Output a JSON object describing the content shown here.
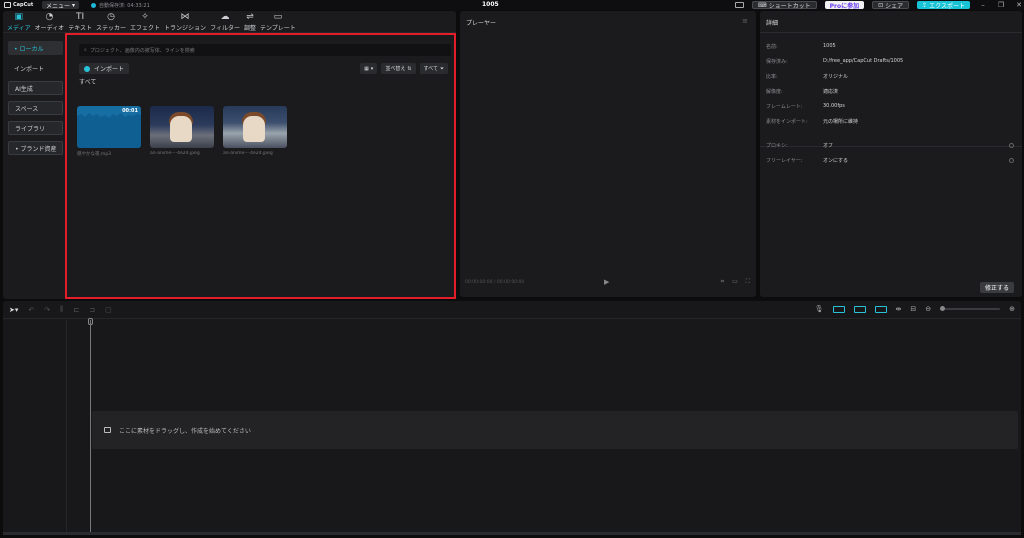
{
  "titlebar": {
    "logo": "CapCut",
    "menu_label": "メニュー",
    "autosave": "自動保存済: 04:33:21",
    "project_title": "1005",
    "shortcut_label": "ショートカット",
    "pro_label": "Proに参加",
    "share_label": "シェア",
    "export_label": "エクスポート"
  },
  "tabs": [
    {
      "label": "メディア",
      "icon": "▣"
    },
    {
      "label": "オーディオ",
      "icon": "◔"
    },
    {
      "label": "テキスト",
      "icon": "TI"
    },
    {
      "label": "ステッカー",
      "icon": "◷"
    },
    {
      "label": "エフェクト",
      "icon": "✧"
    },
    {
      "label": "トランジション",
      "icon": "⋈"
    },
    {
      "label": "フィルター",
      "icon": "☁"
    },
    {
      "label": "調整",
      "icon": "⇌"
    },
    {
      "label": "テンプレート",
      "icon": "▭"
    }
  ],
  "sidebar": {
    "items": [
      "• ローカル",
      "インポート",
      "AI生成",
      "スペース",
      "ライブラリ",
      "• ブランド資産"
    ]
  },
  "media": {
    "search_placeholder": "プロジェクト、画像内の被写体、ラインを検索",
    "import_label": "インポート",
    "sort_label": "並べ替え",
    "filter_label": "すべて",
    "all_label": "すべて",
    "items": [
      {
        "caption": "穏やかな夜.mp3",
        "overlay": "00:01"
      },
      {
        "caption": "an-anime-···4e2d.jpeg",
        "overlay": ""
      },
      {
        "caption": "an-anime-···4e2d.jpeg",
        "overlay": ""
      }
    ]
  },
  "player": {
    "title": "プレーヤー",
    "timecode": "00:00:00:00 / 00:00:00:00"
  },
  "details": {
    "title": "詳細",
    "rows": [
      {
        "key": "名前:",
        "value": "1005"
      },
      {
        "key": "保存済み:",
        "value": "D:/free_app/CapCut Drafts/1005"
      },
      {
        "key": "比率:",
        "value": "オリジナル"
      },
      {
        "key": "解像度:",
        "value": "適応済"
      },
      {
        "key": "フレームレート:",
        "value": "30.00fps"
      },
      {
        "key": "素材をインポート:",
        "value": "元の場所に維持"
      }
    ],
    "rows2": [
      {
        "key": "プロキシ:",
        "value": "オフ"
      },
      {
        "key": "フリーレイヤー:",
        "value": "オンにする"
      }
    ],
    "modify_label": "修正する"
  },
  "timeline": {
    "drop_hint": "ここに素材をドラッグし、作成を始めてください"
  }
}
